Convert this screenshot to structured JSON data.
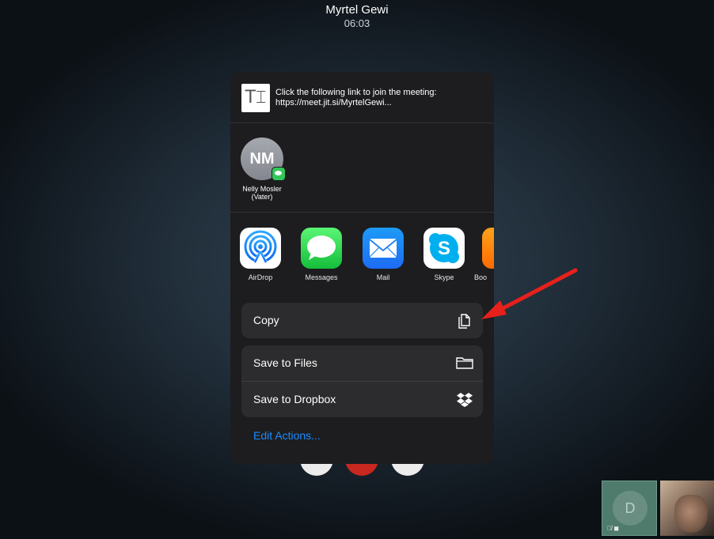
{
  "call": {
    "name": "Myrtel Gewi",
    "timer": "06:03"
  },
  "share_sheet": {
    "doc_icon_glyph": "T⌶",
    "message": "Click the following link to join the meeting: https://meet.jit.si/MyrtelGewi...",
    "contact": {
      "initials": "NM",
      "name": "Nelly Mosler (Vater)",
      "badge_icon": "messages-badge-icon"
    },
    "apps": [
      {
        "label": "AirDrop",
        "icon": "airdrop-icon"
      },
      {
        "label": "Messages",
        "icon": "messages-icon"
      },
      {
        "label": "Mail",
        "icon": "mail-icon"
      },
      {
        "label": "Skype",
        "icon": "skype-icon"
      },
      {
        "label": "Boo",
        "icon": "books-icon"
      }
    ],
    "actions": {
      "copy": "Copy",
      "save_to_files": "Save to Files",
      "save_to_dropbox": "Save to Dropbox"
    },
    "edit_actions": "Edit Actions..."
  },
  "tiles": {
    "remote_initial": "D"
  },
  "colors": {
    "accent_blue": "#1a8cff",
    "hangup_red": "#c8281f",
    "annotation_arrow": "#e8201b"
  }
}
